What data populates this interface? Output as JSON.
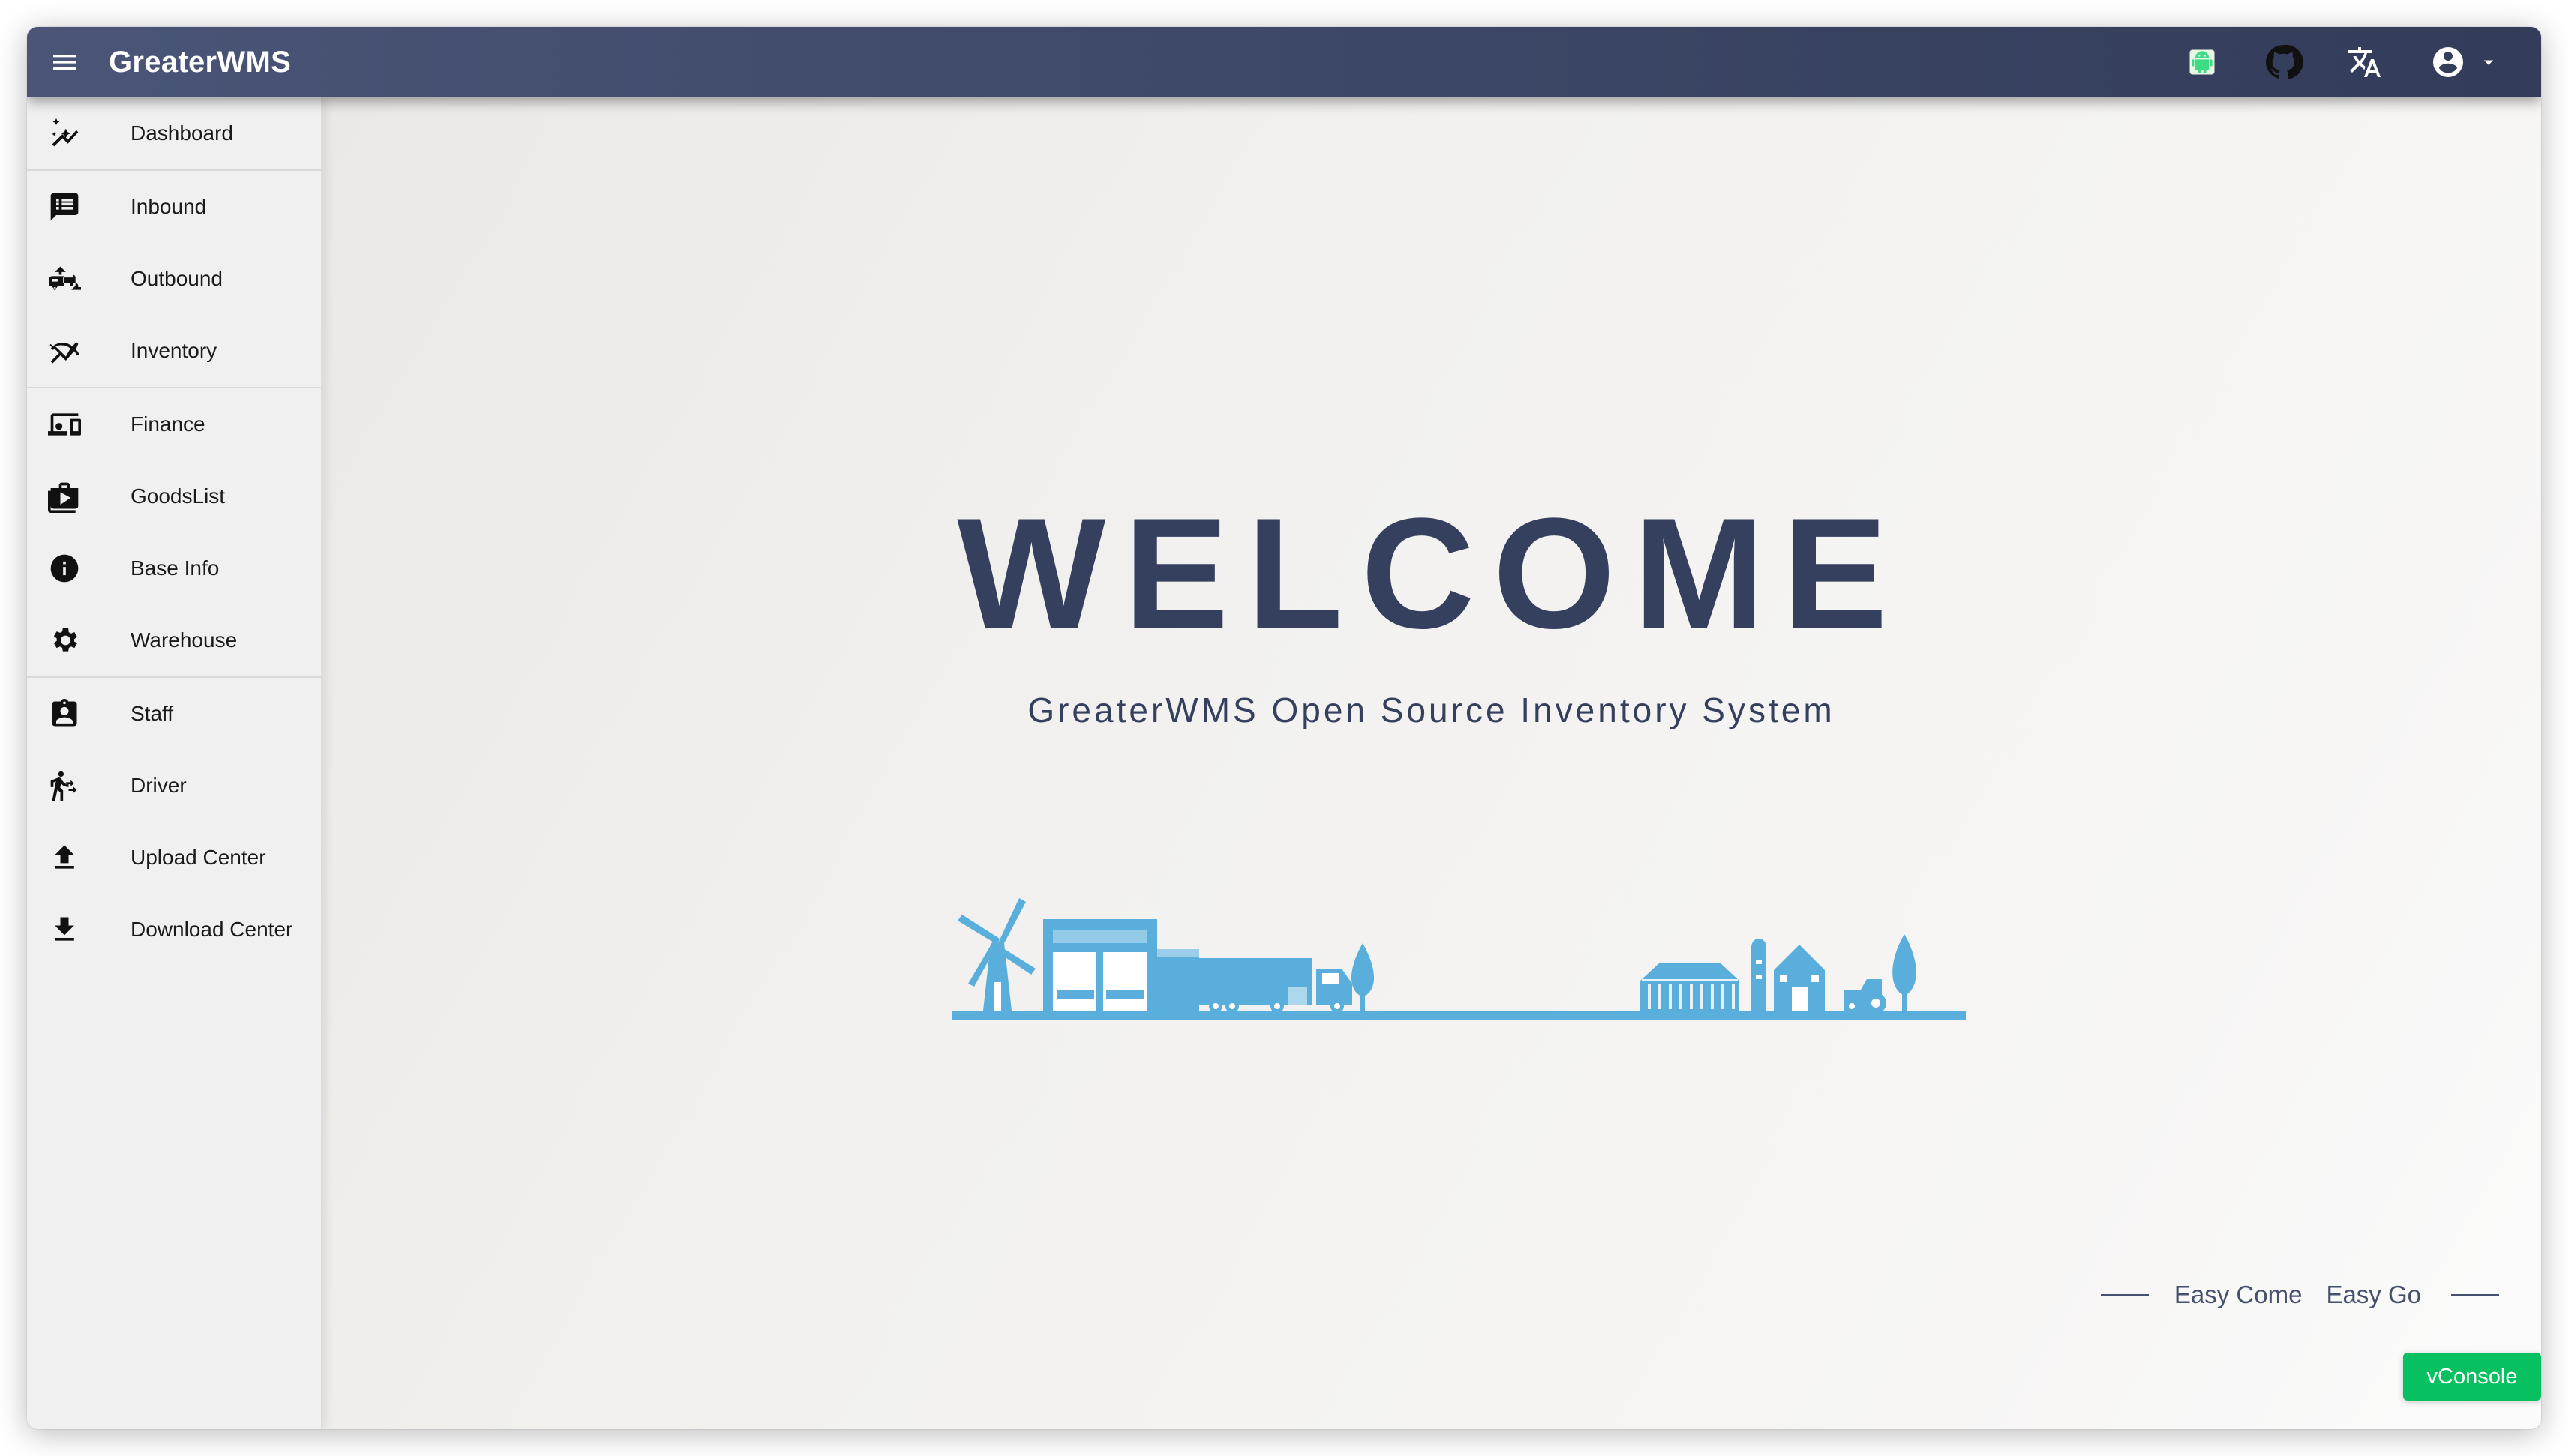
{
  "appbar": {
    "title": "GreaterWMS",
    "icons": [
      "menu-icon",
      "android-icon",
      "github-icon",
      "translate-icon",
      "account-circle-icon",
      "caret-down-icon"
    ]
  },
  "sidebar": {
    "items": [
      {
        "label": "Dashboard",
        "icon": "auto-graph-icon"
      },
      {
        "label": "Inbound",
        "icon": "receipt-long-icon"
      },
      {
        "label": "Outbound",
        "icon": "rv-hookup-icon"
      },
      {
        "label": "Inventory",
        "icon": "multiline-chart-icon"
      },
      {
        "label": "Finance",
        "icon": "devices-icon"
      },
      {
        "label": "GoodsList",
        "icon": "shop-icon"
      },
      {
        "label": "Base Info",
        "icon": "info-icon"
      },
      {
        "label": "Warehouse",
        "icon": "settings-icon"
      },
      {
        "label": "Staff",
        "icon": "assignment-ind-icon"
      },
      {
        "label": "Driver",
        "icon": "transfer-within-station-icon"
      },
      {
        "label": "Upload Center",
        "icon": "upload-icon"
      },
      {
        "label": "Download Center",
        "icon": "download-icon"
      }
    ]
  },
  "main": {
    "welcome": "WELCOME",
    "subtitle": "GreaterWMS Open Source Inventory System",
    "slogan_1": "Easy Come",
    "slogan_2": "Easy Go"
  },
  "vconsole": {
    "label": "vConsole"
  },
  "colors": {
    "appbar": "#3c4666",
    "welcome_text": "#353f5e",
    "illustration": "#5aaedb",
    "vconsole": "#07c160"
  }
}
